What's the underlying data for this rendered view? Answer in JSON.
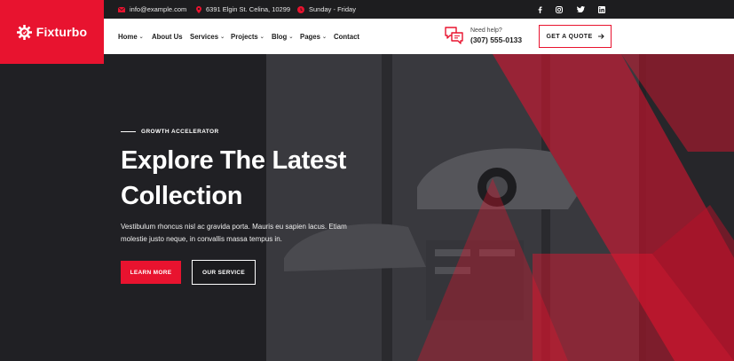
{
  "topbar": {
    "email": "info@example.com",
    "address": "6391 Elgin St. Celina, 10299",
    "hours": "Sunday - Friday",
    "social": [
      "facebook-icon",
      "instagram-icon",
      "twitter-icon",
      "linkedin-icon"
    ]
  },
  "brand": {
    "name": "Fixturbo",
    "color": "#e8132f"
  },
  "nav": {
    "items": [
      {
        "label": "Home",
        "dropdown": true
      },
      {
        "label": "About Us",
        "dropdown": false
      },
      {
        "label": "Services",
        "dropdown": true
      },
      {
        "label": "Projects",
        "dropdown": true
      },
      {
        "label": "Blog",
        "dropdown": true
      },
      {
        "label": "Pages",
        "dropdown": true
      },
      {
        "label": "Contact",
        "dropdown": false
      }
    ],
    "help_label": "Need help?",
    "help_phone": "(307) 555-0133",
    "quote_label": "GET A QUOTE"
  },
  "hero": {
    "eyebrow": "GROWTH ACCELERATOR",
    "title_line1": "Explore The Latest",
    "title_line2": "Collection",
    "desc_line1": "Vestibulum rhoncus nisl ac gravida porta. Mauris eu sapien lacus. Etiam",
    "desc_line2": "molestie justo neque, in convallis massa tempus in.",
    "primary_label": "LEARN MORE",
    "secondary_label": "OUR SERVICE"
  }
}
